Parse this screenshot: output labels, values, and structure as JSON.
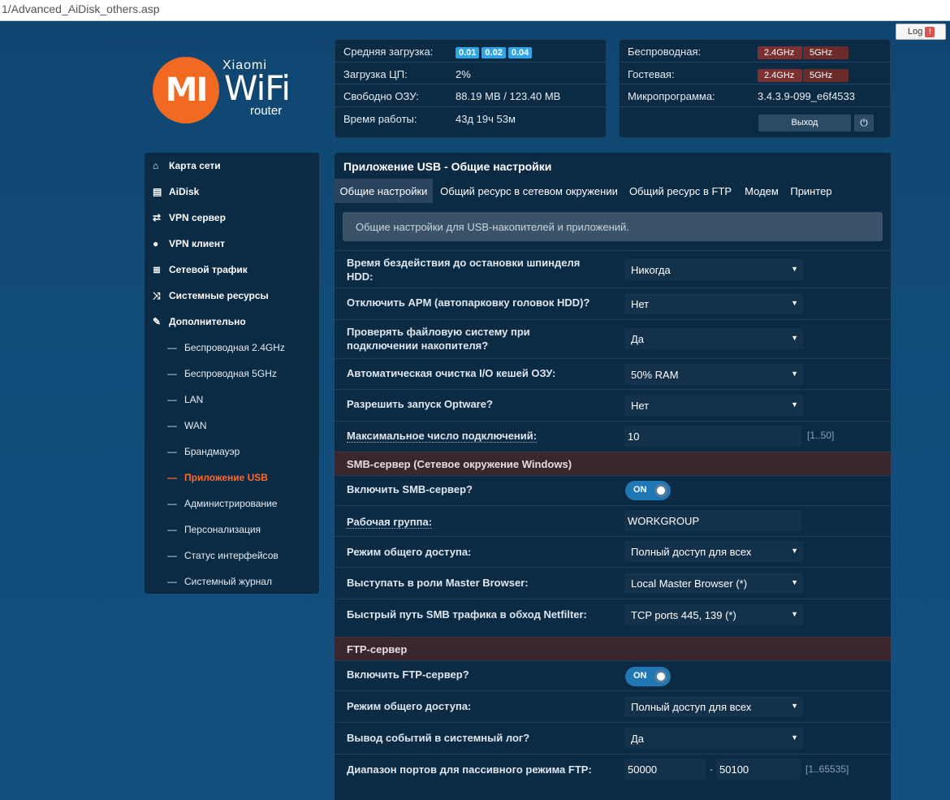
{
  "browser": {
    "url": "1/Advanced_AiDisk_others.asp"
  },
  "log_button": {
    "label": "Log",
    "alert": "!"
  },
  "logo": {
    "brand": "Xiaomi",
    "mark": "mi",
    "wifi": "WiFi",
    "router": "router"
  },
  "system_status": {
    "rows": [
      {
        "label": "Средняя загрузка:",
        "badges": [
          "0.01",
          "0.02",
          "0.04"
        ]
      },
      {
        "label": "Загрузка ЦП:",
        "value": "2%"
      },
      {
        "label": "Свободно ОЗУ:",
        "value": "88.19 MB / 123.40 MB"
      },
      {
        "label": "Время работы:",
        "value": "43д 19ч 53м"
      }
    ]
  },
  "network_status": {
    "wireless_label": "Беспроводная:",
    "guest_label": "Гостевая:",
    "firmware_label": "Микропрограмма:",
    "firmware_value": "3.4.3.9-099_e6f4533",
    "band_24": "2.4GHz",
    "band_5": "5GHz",
    "exit_label": "Выход",
    "power_icon": "⏻"
  },
  "sidebar": {
    "items": [
      {
        "label": "Карта сети",
        "icon": "home-icon"
      },
      {
        "label": "AiDisk",
        "icon": "drive-icon"
      },
      {
        "label": "VPN сервер",
        "icon": "retweet-icon"
      },
      {
        "label": "VPN клиент",
        "icon": "globe-icon"
      },
      {
        "label": "Сетевой трафик",
        "icon": "list-icon"
      },
      {
        "label": "Системные ресурсы",
        "icon": "shuffle-icon"
      },
      {
        "label": "Дополнительно",
        "icon": "wrench-icon"
      }
    ],
    "subitems": [
      "Беспроводная 2.4GHz",
      "Беспроводная 5GHz",
      "LAN",
      "WAN",
      "Брандмауэр",
      "Приложение USB",
      "Администрирование",
      "Персонализация",
      "Статус интерфейсов",
      "Системный журнал"
    ],
    "active_subitem": "Приложение USB"
  },
  "main": {
    "title": "Приложение USB - Общие настройки",
    "tabs": [
      "Общие настройки",
      "Общий ресурс в сетевом окружении",
      "Общий ресурс в FTP",
      "Модем",
      "Принтер"
    ],
    "info": "Общие настройки для USB-накопителей и приложений.",
    "general": [
      {
        "label_1": "Время бездействия до остановки шпинделя",
        "label_2": "HDD:",
        "value": "Никогда"
      },
      {
        "label": "Отключить APM (автопарковку головок HDD)?",
        "value": "Нет"
      },
      {
        "label_1": "Проверять файловую систему при",
        "label_2": "подключении накопителя?",
        "value": "Да"
      },
      {
        "label": "Автоматическая очистка I/O кешей ОЗУ:",
        "value": "50% RAM"
      },
      {
        "label": "Разрешить запуск Optware?",
        "value": "Нет"
      },
      {
        "label": "Максимальное число подключений:",
        "value": "10",
        "hint": "[1..50]"
      }
    ],
    "smb": {
      "header": "SMB-сервер (Сетевое окружение Windows)",
      "enable_label": "Включить SMB-сервер?",
      "enable_state": "ON",
      "workgroup_label": "Рабочая группа:",
      "workgroup_value": "WORKGROUP",
      "access_label": "Режим общего доступа:",
      "access_value": "Полный доступ для всех",
      "master_label": "Выступать в роли Master Browser:",
      "master_value": "Local Master Browser (*)",
      "fastpath_label": "Быстрый путь SMB трафика в обход Netfilter:",
      "fastpath_value": "TCP ports 445, 139 (*)"
    },
    "ftp": {
      "header": "FTP-сервер",
      "enable_label": "Включить FTP-сервер?",
      "enable_state": "ON",
      "access_label": "Режим общего доступа:",
      "access_value": "Полный доступ для всех",
      "log_label": "Вывод событий в системный лог?",
      "log_value": "Да",
      "ports_label": "Диапазон портов для пассивного режима FTP:",
      "port_from": "50000",
      "port_sep": "-",
      "port_to": "50100",
      "ports_hint": "[1..65535]"
    }
  },
  "colors": {
    "accent_orange": "#ff6a2a",
    "badge_blue": "#2fa4e7",
    "band_red": "#7d3030",
    "toggle_blue": "#1f77b4"
  }
}
